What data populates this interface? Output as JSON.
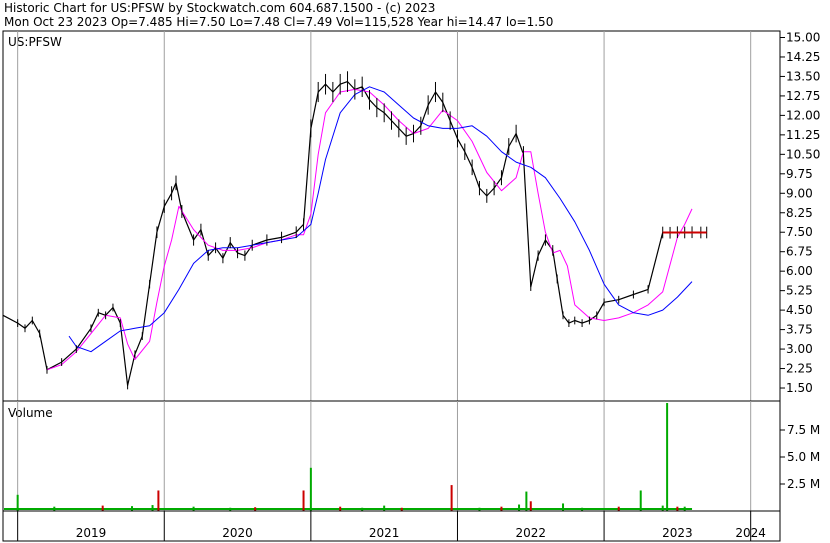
{
  "header": {
    "line1": "Historic Chart for US:PFSW by Stockwatch.com 604.687.1500 - (c) 2023",
    "line2": "Mon Oct 23 2023  Op=7.485  Hi=7.50  Lo=7.48  Cl=7.49  Vol=115,528  Year hi=14.47  lo=1.50"
  },
  "colors": {
    "price": "#000000",
    "ma_fast": "#ff00ff",
    "ma_slow": "#0000ff",
    "vol_up": "#00aa00",
    "vol_down": "#cc0000",
    "last_bar": "#cc0000"
  },
  "chart_data": [
    {
      "type": "line",
      "title": "US:PFSW",
      "y_axis_side": "right",
      "ylim": [
        1.0,
        15.25
      ],
      "y_ticks": [
        "15.00",
        "14.25",
        "13.50",
        "12.75",
        "12.00",
        "11.25",
        "10.50",
        "9.75",
        "9.00",
        "8.25",
        "7.50",
        "6.75",
        "6.00",
        "5.25",
        "4.50",
        "3.75",
        "3.00",
        "2.25",
        "1.50"
      ],
      "x_labels": [
        "2019",
        "2020",
        "2021",
        "2022",
        "2023",
        "2024"
      ],
      "x_range": [
        2018.9,
        2024.2
      ],
      "grid": true,
      "series": [
        {
          "role": "price",
          "x": [
            2018.9,
            2019.0,
            2019.05,
            2019.1,
            2019.15,
            2019.2,
            2019.3,
            2019.4,
            2019.5,
            2019.55,
            2019.6,
            2019.65,
            2019.7,
            2019.75,
            2019.8,
            2019.85,
            2019.9,
            2019.95,
            2020.0,
            2020.05,
            2020.08,
            2020.12,
            2020.2,
            2020.25,
            2020.3,
            2020.35,
            2020.4,
            2020.45,
            2020.5,
            2020.55,
            2020.6,
            2020.7,
            2020.8,
            2020.9,
            2020.95,
            2021.0,
            2021.05,
            2021.1,
            2021.15,
            2021.2,
            2021.25,
            2021.3,
            2021.35,
            2021.4,
            2021.45,
            2021.5,
            2021.55,
            2021.6,
            2021.65,
            2021.7,
            2021.75,
            2021.8,
            2021.85,
            2021.9,
            2021.95,
            2022.0,
            2022.05,
            2022.1,
            2022.15,
            2022.2,
            2022.25,
            2022.3,
            2022.35,
            2022.4,
            2022.45,
            2022.5,
            2022.55,
            2022.6,
            2022.65,
            2022.68,
            2022.72,
            2022.76,
            2022.8,
            2022.85,
            2022.9,
            2022.95,
            2023.0,
            2023.1,
            2023.2,
            2023.3,
            2023.4,
            2023.45,
            2023.5,
            2023.55,
            2023.6,
            2023.66,
            2023.7
          ],
          "values": [
            4.3,
            4.0,
            3.8,
            4.1,
            3.6,
            2.2,
            2.5,
            3.0,
            3.8,
            4.4,
            4.3,
            4.6,
            4.0,
            1.6,
            2.8,
            3.5,
            5.5,
            7.5,
            8.5,
            9.0,
            9.4,
            8.3,
            7.2,
            7.6,
            6.6,
            6.9,
            6.5,
            7.1,
            6.7,
            6.6,
            7.0,
            7.2,
            7.3,
            7.5,
            7.8,
            11.5,
            12.9,
            13.2,
            12.9,
            13.2,
            13.3,
            13.0,
            13.1,
            12.6,
            12.3,
            12.1,
            11.8,
            11.5,
            11.2,
            11.3,
            11.6,
            12.4,
            12.9,
            12.5,
            11.8,
            11.1,
            10.6,
            10.0,
            9.2,
            8.9,
            9.2,
            9.6,
            10.8,
            11.3,
            10.5,
            5.4,
            6.6,
            7.2,
            6.8,
            5.7,
            4.3,
            4.0,
            4.1,
            4.0,
            4.1,
            4.3,
            4.8,
            4.9,
            5.1,
            5.3,
            7.49,
            7.48,
            7.5,
            7.49,
            7.5,
            7.49,
            7.49
          ]
        },
        {
          "role": "ma_fast",
          "x": [
            2019.2,
            2019.3,
            2019.4,
            2019.5,
            2019.6,
            2019.7,
            2019.75,
            2019.8,
            2019.9,
            2019.95,
            2020.0,
            2020.05,
            2020.1,
            2020.2,
            2020.3,
            2020.4,
            2020.5,
            2020.6,
            2020.7,
            2020.8,
            2020.9,
            2020.95,
            2021.0,
            2021.05,
            2021.1,
            2021.2,
            2021.3,
            2021.4,
            2021.5,
            2021.6,
            2021.7,
            2021.8,
            2021.9,
            2022.0,
            2022.1,
            2022.2,
            2022.3,
            2022.4,
            2022.45,
            2022.5,
            2022.55,
            2022.6,
            2022.65,
            2022.7,
            2022.75,
            2022.8,
            2022.9,
            2023.0,
            2023.1,
            2023.2,
            2023.3,
            2023.4,
            2023.5,
            2023.55,
            2023.6
          ],
          "values": [
            2.2,
            2.4,
            2.9,
            3.6,
            4.3,
            4.2,
            3.2,
            2.6,
            3.3,
            4.8,
            6.2,
            7.2,
            8.5,
            7.6,
            7.0,
            6.8,
            6.8,
            6.9,
            7.1,
            7.2,
            7.4,
            7.4,
            8.2,
            10.5,
            12.1,
            12.9,
            13.0,
            12.9,
            12.4,
            11.8,
            11.3,
            11.5,
            12.2,
            11.8,
            11.0,
            9.8,
            9.1,
            9.6,
            10.6,
            10.6,
            9.0,
            7.5,
            6.7,
            6.8,
            6.2,
            4.7,
            4.2,
            4.1,
            4.2,
            4.4,
            4.7,
            5.2,
            7.3,
            7.8,
            8.4
          ]
        },
        {
          "role": "ma_slow",
          "x": [
            2019.35,
            2019.4,
            2019.5,
            2019.6,
            2019.7,
            2019.8,
            2019.9,
            2020.0,
            2020.1,
            2020.2,
            2020.3,
            2020.4,
            2020.5,
            2020.6,
            2020.7,
            2020.8,
            2020.9,
            2021.0,
            2021.05,
            2021.1,
            2021.2,
            2021.3,
            2021.4,
            2021.5,
            2021.6,
            2021.7,
            2021.8,
            2021.9,
            2022.0,
            2022.1,
            2022.2,
            2022.3,
            2022.4,
            2022.5,
            2022.6,
            2022.7,
            2022.8,
            2022.9,
            2023.0,
            2023.1,
            2023.2,
            2023.3,
            2023.4,
            2023.5,
            2023.6
          ],
          "values": [
            3.5,
            3.1,
            2.9,
            3.3,
            3.7,
            3.8,
            3.9,
            4.4,
            5.3,
            6.3,
            6.8,
            6.9,
            6.9,
            7.0,
            7.1,
            7.2,
            7.3,
            7.8,
            9.0,
            10.3,
            12.1,
            12.8,
            13.1,
            12.9,
            12.4,
            11.9,
            11.6,
            11.5,
            11.5,
            11.6,
            11.2,
            10.6,
            10.2,
            10.0,
            9.6,
            8.8,
            7.9,
            6.8,
            5.5,
            4.7,
            4.4,
            4.3,
            4.5,
            5.0,
            5.6
          ]
        }
      ]
    },
    {
      "type": "bar",
      "title": "Volume",
      "y_axis_side": "right",
      "ylim": [
        0,
        10
      ],
      "y_ticks": [
        "7.5 M",
        "5.0 M",
        "2.5 M"
      ],
      "y_tick_values": [
        7.5,
        5.0,
        2.5
      ],
      "unit": "M",
      "spikes": [
        {
          "x": 2019.0,
          "value": 1.5,
          "up": true
        },
        {
          "x": 2019.25,
          "value": 0.4,
          "up": true
        },
        {
          "x": 2019.58,
          "value": 0.5,
          "up": false
        },
        {
          "x": 2019.78,
          "value": 0.45,
          "up": true
        },
        {
          "x": 2019.92,
          "value": 0.55,
          "up": true
        },
        {
          "x": 2019.96,
          "value": 1.9,
          "up": false
        },
        {
          "x": 2020.2,
          "value": 0.4,
          "up": true
        },
        {
          "x": 2020.45,
          "value": 0.3,
          "up": true
        },
        {
          "x": 2020.62,
          "value": 0.35,
          "up": false
        },
        {
          "x": 2020.95,
          "value": 1.9,
          "up": false
        },
        {
          "x": 2021.0,
          "value": 4.0,
          "up": true
        },
        {
          "x": 2021.2,
          "value": 0.4,
          "up": false
        },
        {
          "x": 2021.35,
          "value": 0.3,
          "up": true
        },
        {
          "x": 2021.5,
          "value": 0.5,
          "up": true
        },
        {
          "x": 2021.62,
          "value": 0.3,
          "up": false
        },
        {
          "x": 2021.96,
          "value": 2.4,
          "up": false
        },
        {
          "x": 2022.15,
          "value": 0.3,
          "up": true
        },
        {
          "x": 2022.3,
          "value": 0.4,
          "up": false
        },
        {
          "x": 2022.42,
          "value": 0.6,
          "up": true
        },
        {
          "x": 2022.47,
          "value": 1.8,
          "up": true
        },
        {
          "x": 2022.5,
          "value": 0.9,
          "up": false
        },
        {
          "x": 2022.72,
          "value": 0.7,
          "up": true
        },
        {
          "x": 2022.85,
          "value": 0.3,
          "up": true
        },
        {
          "x": 2023.1,
          "value": 0.4,
          "up": false
        },
        {
          "x": 2023.25,
          "value": 1.9,
          "up": true
        },
        {
          "x": 2023.4,
          "value": 0.5,
          "up": true
        },
        {
          "x": 2023.43,
          "value": 10.0,
          "up": true
        },
        {
          "x": 2023.5,
          "value": 0.4,
          "up": false
        },
        {
          "x": 2023.55,
          "value": 0.4,
          "up": true
        }
      ]
    }
  ]
}
